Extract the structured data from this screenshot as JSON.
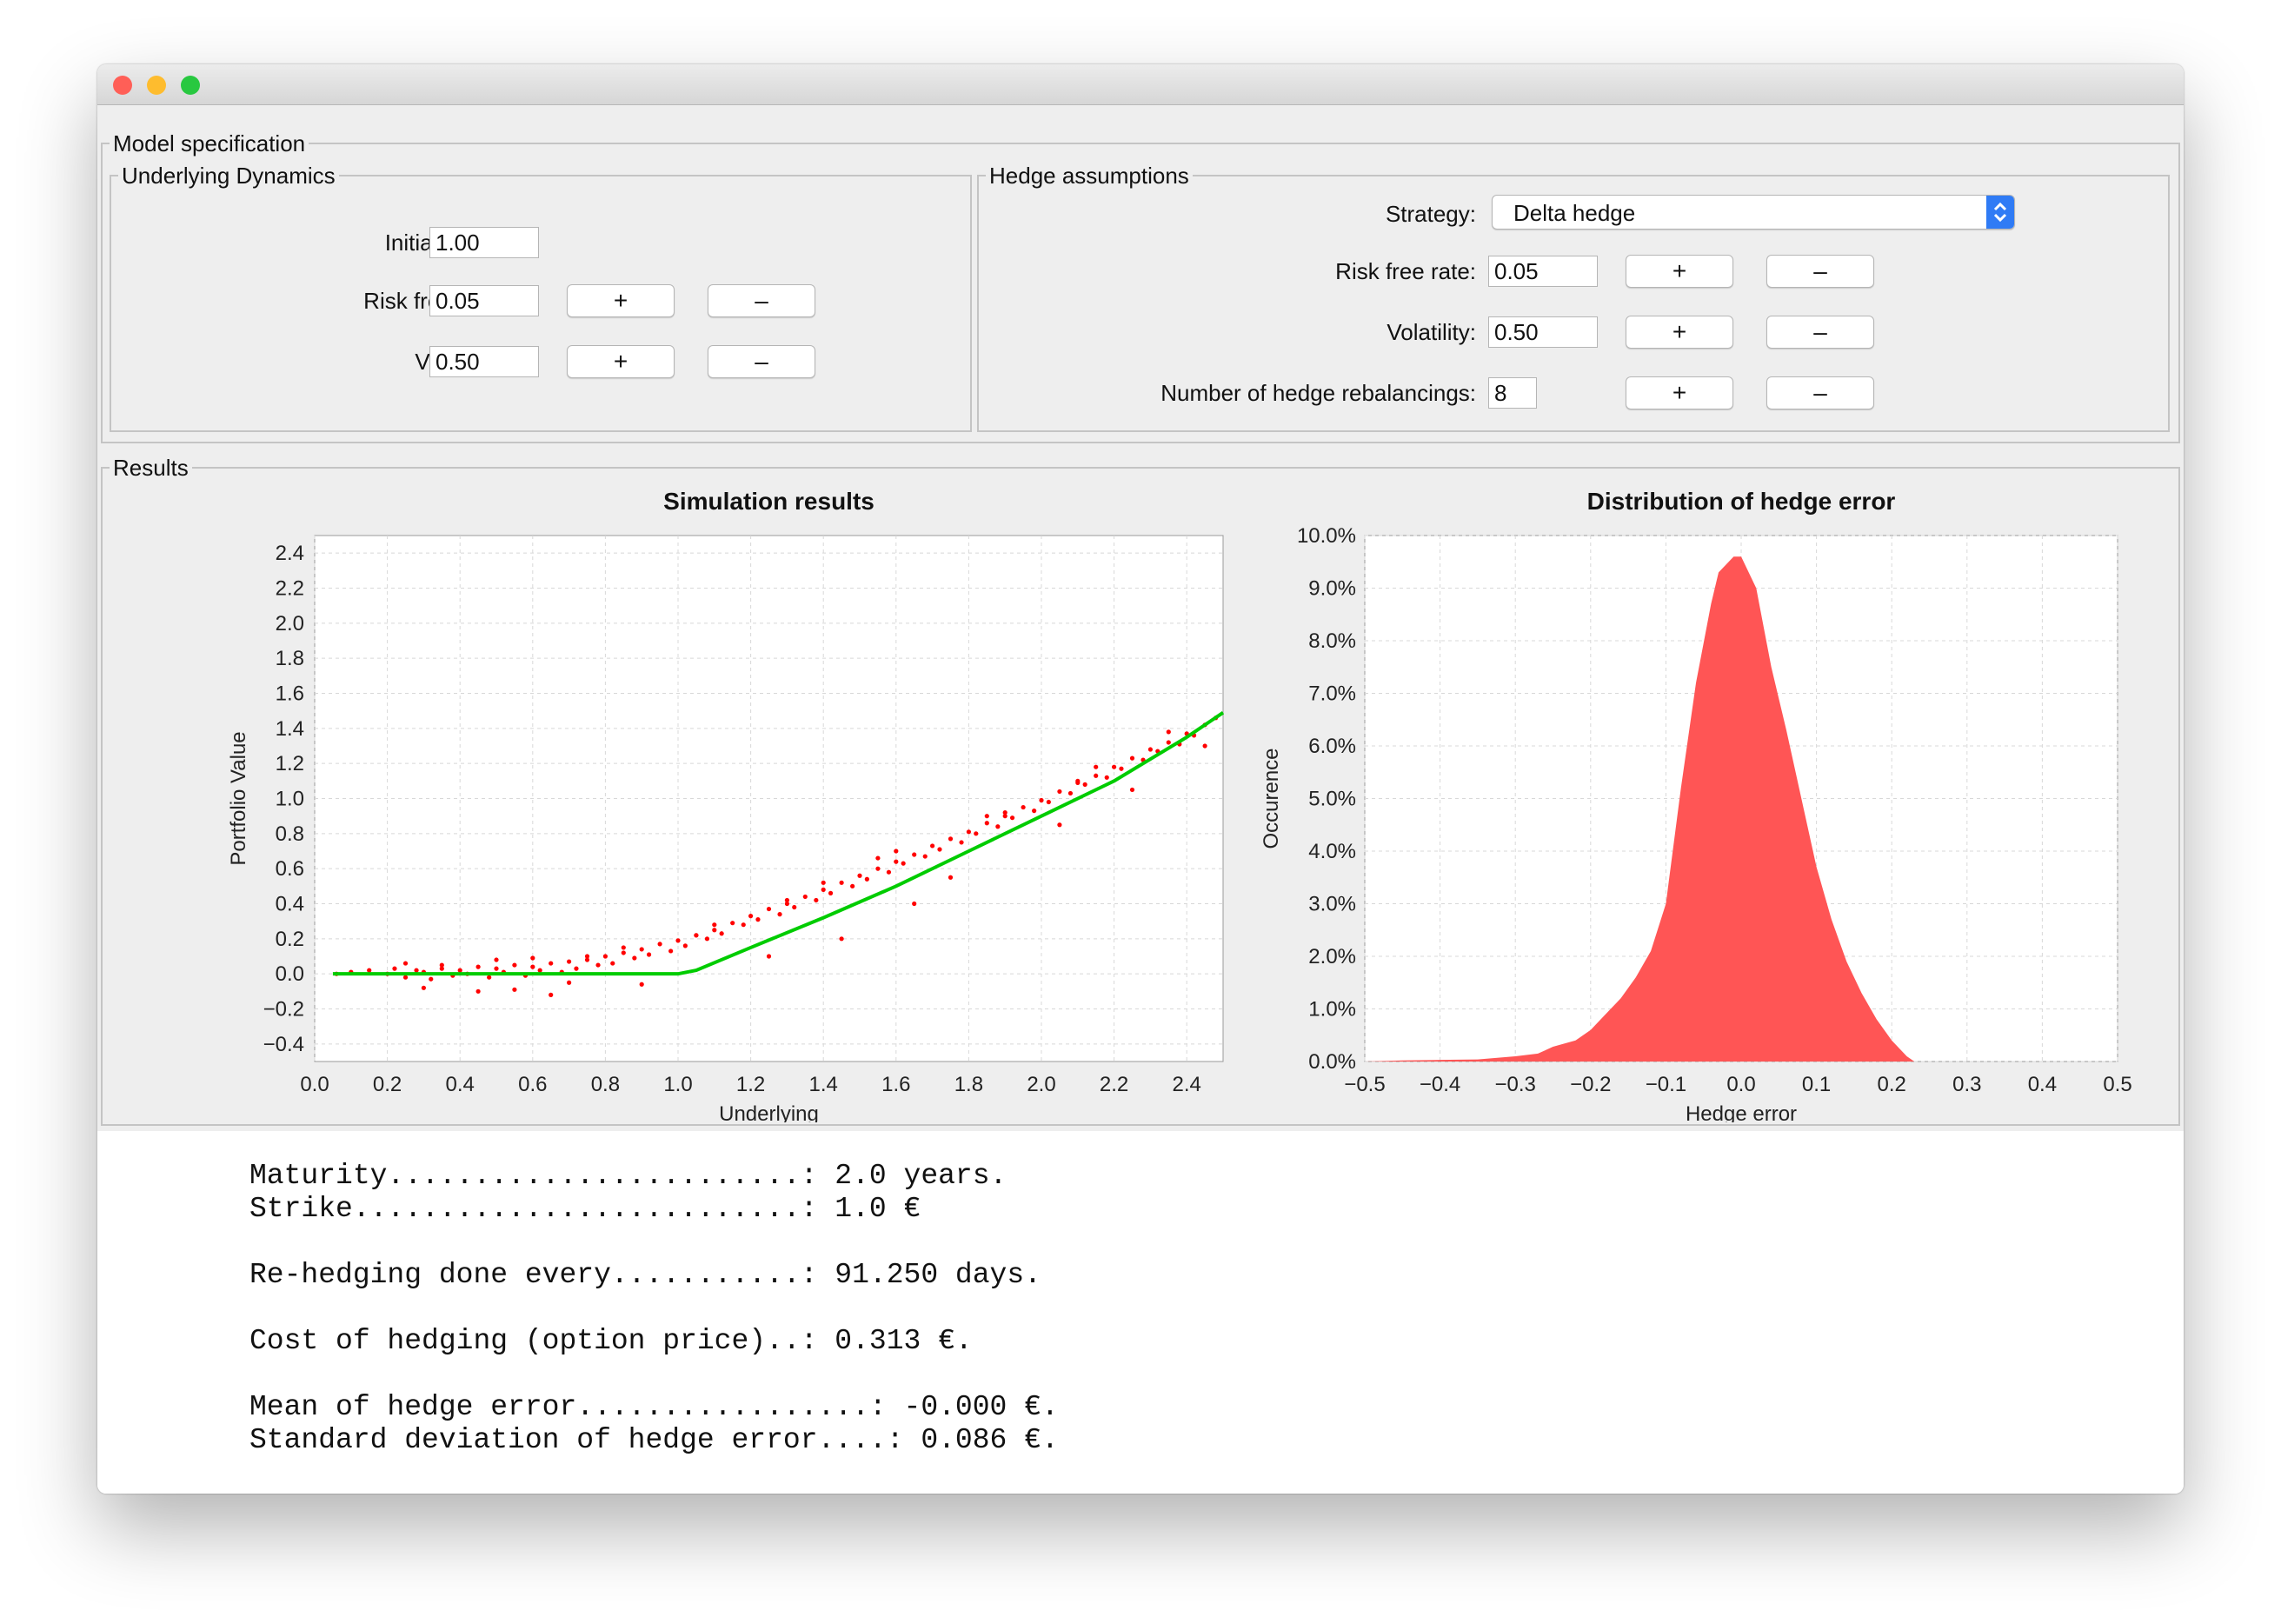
{
  "window": {
    "traffic_lights": [
      {
        "name": "close",
        "color": "#ff5f57"
      },
      {
        "name": "minimize",
        "color": "#febc2e"
      },
      {
        "name": "zoom",
        "color": "#28c840"
      }
    ]
  },
  "model_specification": {
    "legend": "Model specification",
    "underlying_dynamics": {
      "legend": "Underlying Dynamics",
      "initial_value_label": "Initial value:",
      "initial_value": "1.00",
      "risk_free_rate_label": "Risk free rate:",
      "risk_free_rate": "0.05",
      "volatility_label": "Volatility:",
      "volatility": "0.50",
      "plus_label": "+",
      "minus_label": "–"
    },
    "hedge_assumptions": {
      "legend": "Hedge assumptions",
      "strategy_label": "Strategy:",
      "strategy": "Delta hedge",
      "risk_free_rate_label": "Risk free rate:",
      "risk_free_rate": "0.05",
      "volatility_label": "Volatility:",
      "volatility": "0.50",
      "rebalancings_label": "Number of hedge rebalancings:",
      "rebalancings": "8",
      "plus_label": "+",
      "minus_label": "–"
    }
  },
  "results": {
    "legend": "Results",
    "output_lines": [
      "Maturity........................: 2.0 years.",
      "Strike..........................: 1.0 €",
      "",
      "Re-hedging done every...........: 91.250 days.",
      "",
      "Cost of hedging (option price)..: 0.313 €.",
      "",
      "Mean of hedge error.................: -0.000 €.",
      "Standard deviation of hedge error....: 0.086 €."
    ]
  },
  "chart_data": [
    {
      "type": "scatter",
      "title": "Simulation results",
      "xlabel": "Underlying",
      "ylabel": "Portfolio Value",
      "xlim": [
        0.0,
        2.5
      ],
      "ylim": [
        -0.5,
        2.5
      ],
      "x_ticks": [
        0.0,
        0.2,
        0.4,
        0.6,
        0.8,
        1.0,
        1.2,
        1.4,
        1.6,
        1.8,
        2.0,
        2.2,
        2.4
      ],
      "y_ticks": [
        -0.4,
        -0.2,
        0.0,
        0.2,
        0.4,
        0.6,
        0.8,
        1.0,
        1.2,
        1.4,
        1.6,
        1.8,
        2.0,
        2.2,
        2.4
      ],
      "grid": true,
      "series": [
        {
          "kind": "scatter",
          "color": "#ff0000",
          "x": [
            0.06,
            0.1,
            0.15,
            0.2,
            0.22,
            0.25,
            0.28,
            0.3,
            0.32,
            0.35,
            0.38,
            0.4,
            0.42,
            0.45,
            0.48,
            0.5,
            0.52,
            0.55,
            0.58,
            0.6,
            0.62,
            0.65,
            0.68,
            0.7,
            0.72,
            0.75,
            0.78,
            0.8,
            0.82,
            0.85,
            0.88,
            0.9,
            0.92,
            0.95,
            0.98,
            1.0,
            1.02,
            1.05,
            1.08,
            1.1,
            1.12,
            1.15,
            1.18,
            1.2,
            1.22,
            1.25,
            1.28,
            1.3,
            1.32,
            1.35,
            1.38,
            1.4,
            1.42,
            1.45,
            1.48,
            1.5,
            1.52,
            1.55,
            1.58,
            1.6,
            1.62,
            1.65,
            1.68,
            1.7,
            1.72,
            1.75,
            1.78,
            1.8,
            1.82,
            1.85,
            1.88,
            1.9,
            1.92,
            1.95,
            1.98,
            2.0,
            2.02,
            2.05,
            2.08,
            2.1,
            2.12,
            2.15,
            2.18,
            2.2,
            2.22,
            2.25,
            2.28,
            2.3,
            2.32,
            2.35,
            2.38,
            2.4,
            2.42,
            2.45,
            2.48,
            0.3,
            0.45,
            0.55,
            0.65,
            0.7,
            0.9,
            1.25,
            1.45,
            1.65,
            1.75,
            2.05,
            2.25,
            2.45,
            0.25,
            0.5,
            0.75,
            1.1,
            1.4,
            1.6,
            1.9,
            2.15,
            0.35,
            0.6,
            0.85,
            1.05,
            1.3,
            1.55,
            1.85,
            2.1,
            2.35
          ],
          "y": [
            0.0,
            0.01,
            0.02,
            0.0,
            0.03,
            -0.02,
            0.02,
            0.01,
            -0.03,
            0.03,
            -0.01,
            0.02,
            0.0,
            0.04,
            -0.02,
            0.03,
            0.01,
            0.05,
            -0.01,
            0.04,
            0.02,
            0.06,
            0.01,
            0.07,
            0.03,
            0.08,
            0.05,
            0.1,
            0.06,
            0.12,
            0.09,
            0.14,
            0.11,
            0.17,
            0.13,
            0.19,
            0.16,
            0.22,
            0.2,
            0.25,
            0.23,
            0.29,
            0.28,
            0.33,
            0.31,
            0.37,
            0.34,
            0.4,
            0.38,
            0.44,
            0.42,
            0.48,
            0.46,
            0.52,
            0.5,
            0.56,
            0.54,
            0.6,
            0.58,
            0.64,
            0.63,
            0.68,
            0.67,
            0.73,
            0.71,
            0.77,
            0.75,
            0.81,
            0.8,
            0.86,
            0.84,
            0.9,
            0.89,
            0.95,
            0.93,
            0.99,
            0.98,
            1.04,
            1.03,
            1.09,
            1.08,
            1.13,
            1.12,
            1.18,
            1.17,
            1.23,
            1.22,
            1.28,
            1.27,
            1.32,
            1.31,
            1.37,
            1.36,
            1.42,
            1.46,
            -0.08,
            -0.1,
            -0.09,
            -0.12,
            -0.05,
            -0.06,
            0.1,
            0.2,
            0.4,
            0.55,
            0.85,
            1.05,
            1.3,
            0.06,
            0.08,
            0.1,
            0.28,
            0.52,
            0.7,
            0.92,
            1.18,
            0.05,
            0.09,
            0.15,
            0.22,
            0.42,
            0.66,
            0.9,
            1.1,
            1.38
          ]
        },
        {
          "kind": "line",
          "color": "#00cc00",
          "x": [
            0.05,
            0.2,
            0.4,
            0.6,
            0.8,
            1.0,
            1.05,
            1.2,
            1.4,
            1.6,
            1.8,
            2.0,
            2.2,
            2.4,
            2.5
          ],
          "y": [
            0.0,
            0.0,
            0.0,
            0.0,
            0.0,
            0.0,
            0.02,
            0.15,
            0.32,
            0.5,
            0.7,
            0.9,
            1.1,
            1.35,
            1.49
          ]
        }
      ]
    },
    {
      "type": "area",
      "title": "Distribution of hedge error",
      "xlabel": "Hedge error",
      "ylabel": "Occurence",
      "xlim": [
        -0.5,
        0.5
      ],
      "ylim": [
        0.0,
        0.1
      ],
      "x_ticks": [
        "−0.5",
        "−0.4",
        "−0.3",
        "−0.2",
        "−0.1",
        "0.0",
        "0.1",
        "0.2",
        "0.3",
        "0.4",
        "0.5"
      ],
      "y_ticks": [
        "0.0%",
        "1.0%",
        "2.0%",
        "3.0%",
        "4.0%",
        "5.0%",
        "6.0%",
        "7.0%",
        "8.0%",
        "9.0%",
        "10.0%"
      ],
      "grid": true,
      "color": "#ff5555",
      "x": [
        -0.5,
        -0.45,
        -0.4,
        -0.35,
        -0.3,
        -0.27,
        -0.25,
        -0.22,
        -0.2,
        -0.18,
        -0.16,
        -0.14,
        -0.12,
        -0.1,
        -0.08,
        -0.06,
        -0.04,
        -0.03,
        -0.01,
        0.0,
        0.02,
        0.04,
        0.06,
        0.08,
        0.1,
        0.12,
        0.14,
        0.16,
        0.18,
        0.2,
        0.22,
        0.23
      ],
      "y": [
        0.0,
        0.0002,
        0.0003,
        0.0004,
        0.001,
        0.0015,
        0.0028,
        0.004,
        0.006,
        0.009,
        0.012,
        0.016,
        0.021,
        0.03,
        0.052,
        0.072,
        0.087,
        0.093,
        0.096,
        0.096,
        0.09,
        0.075,
        0.063,
        0.05,
        0.037,
        0.027,
        0.019,
        0.013,
        0.008,
        0.004,
        0.001,
        0.0
      ]
    }
  ]
}
